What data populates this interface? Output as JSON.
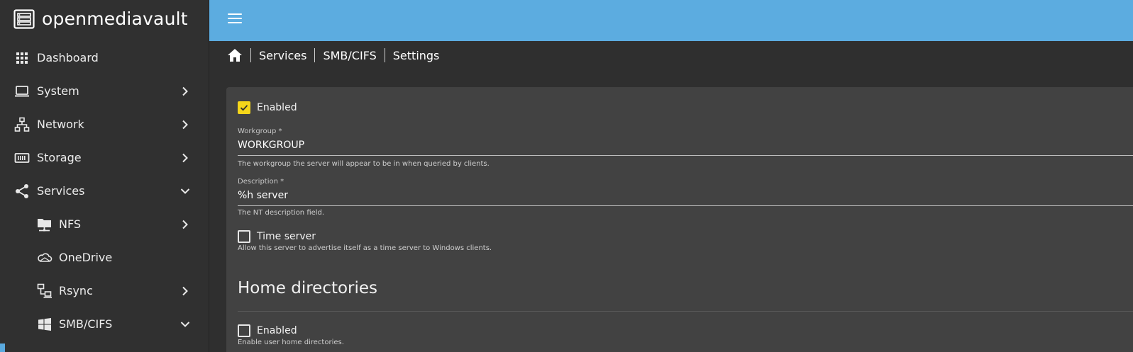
{
  "app": {
    "brand": "openmediavault"
  },
  "sidebar": {
    "items": [
      {
        "label": "Dashboard",
        "icon": "grid-icon"
      },
      {
        "label": "System",
        "icon": "laptop-icon"
      },
      {
        "label": "Network",
        "icon": "network-icon"
      },
      {
        "label": "Storage",
        "icon": "storage-icon"
      },
      {
        "label": "Services",
        "icon": "share-icon"
      },
      {
        "label": "NFS",
        "icon": "folder-network-icon"
      },
      {
        "label": "OneDrive",
        "icon": "cloud-icon"
      },
      {
        "label": "Rsync",
        "icon": "sync-computers-icon"
      },
      {
        "label": "SMB/CIFS",
        "icon": "windows-icon"
      }
    ]
  },
  "breadcrumb": {
    "items": [
      "Services",
      "SMB/CIFS",
      "Settings"
    ]
  },
  "form": {
    "enabled": {
      "label": "Enabled",
      "checked": true
    },
    "workgroup": {
      "label": "Workgroup *",
      "value": "WORKGROUP",
      "hint": "The workgroup the server will appear to be in when queried by clients."
    },
    "description": {
      "label": "Description *",
      "value": "%h server",
      "hint": "The NT description field."
    },
    "time_server": {
      "label": "Time server",
      "checked": false,
      "hint": "Allow this server to advertise itself as a time server to Windows clients."
    },
    "home_directories": {
      "title": "Home directories",
      "enabled_label": "Enabled",
      "enabled_checked": false,
      "hint": "Enable user home directories."
    }
  },
  "colors": {
    "topbar": "#5cace0",
    "sidebar": "#303030",
    "card": "#424242",
    "checkbox_accent": "#f5d61a"
  }
}
